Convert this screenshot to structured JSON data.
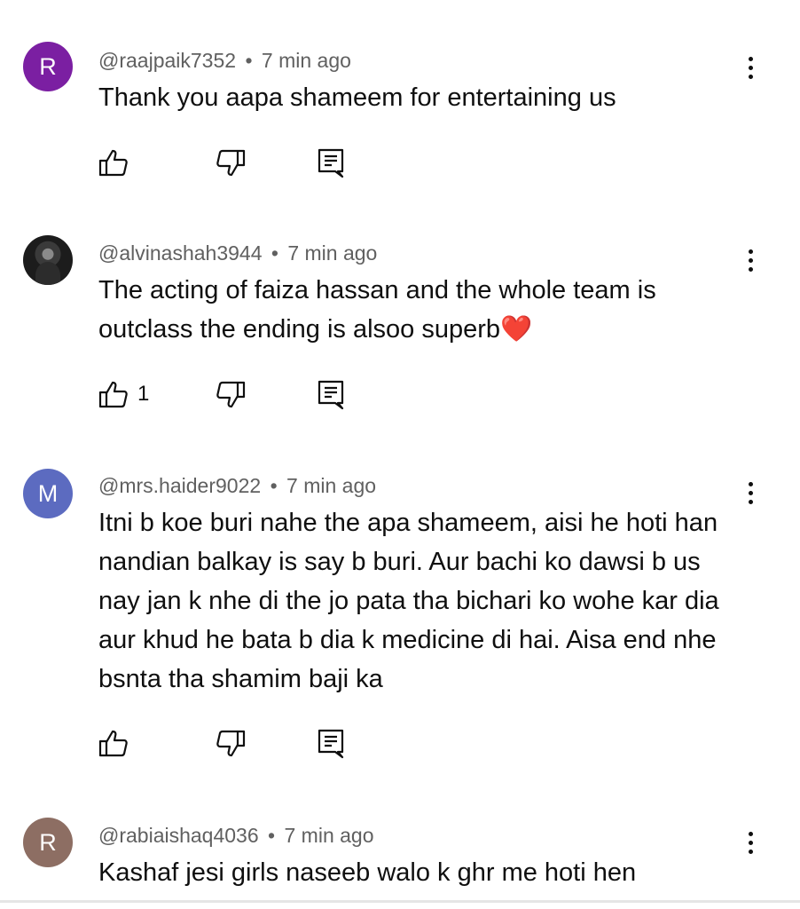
{
  "comments": [
    {
      "avatar_letter": "R",
      "avatar_color": "#7b1fa2",
      "author": "@raajpaik7352",
      "separator": "•",
      "time": "7 min ago",
      "text": "Thank you aapa shameem for entertaining us",
      "likes": ""
    },
    {
      "avatar_letter": "",
      "avatar_color": "#1c1c1c",
      "author": "@alvinashah3944",
      "separator": "•",
      "time": "7 min ago",
      "text": "The acting of faiza hassan and the whole team is outclass the ending is alsoo superb❤️",
      "likes": "1"
    },
    {
      "avatar_letter": "M",
      "avatar_color": "#5c6bc0",
      "author": "@mrs.haider9022",
      "separator": "•",
      "time": "7 min ago",
      "text": "Itni b koe buri nahe the apa shameem, aisi he hoti han nandian balkay is say b buri. Aur bachi ko dawsi b us nay jan k nhe di the jo pata tha bichari ko wohe kar dia aur khud he bata b dia k medicine di hai. Aisa end nhe bsnta tha shamim baji ka",
      "likes": ""
    },
    {
      "avatar_letter": "R",
      "avatar_color": "#8d6e63",
      "author": "@rabiaishaq4036",
      "separator": "•",
      "time": "7 min ago",
      "text": "Kashaf jesi girls naseeb walo k ghr me hoti hen",
      "likes": ""
    }
  ],
  "icons": {
    "like": "thumbs-up-icon",
    "dislike": "thumbs-down-icon",
    "reply": "reply-comment-icon",
    "menu": "more-vertical-icon"
  },
  "colors": {
    "text": "#0f0f0f",
    "meta": "#606060"
  }
}
